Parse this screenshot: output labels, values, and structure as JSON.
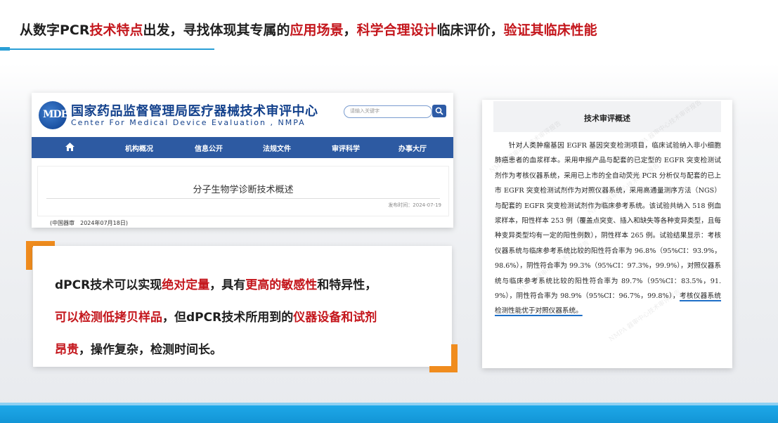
{
  "title": {
    "part1": "从数字PCR",
    "part2_red": "技术特点",
    "part3": "出发，寻找体现其专属的",
    "part4_red": "应用场景",
    "part5": "，",
    "part6_red": "科学合理设计",
    "part7": "临床评价，",
    "part8_red": "验证其临床性能"
  },
  "website": {
    "logo_text": "MDE",
    "org_name_cn": "国家药品监督管理局医疗器械技术审评中心",
    "org_name_en": "Center For Medical Device Evaluation , NMPA",
    "search_placeholder": "请输入关键字",
    "nav": [
      "机构概况",
      "信息公开",
      "法规文件",
      "审评科学",
      "办事大厅"
    ],
    "article_title": "分子生物学诊断技术概述",
    "article_date": "发布时间：2024-07-19",
    "source_note": "(中国器审　2024年07月18日)"
  },
  "highlight": {
    "line1_a": "dPCR技术可以实现",
    "line1_b_red": "绝对定量",
    "line1_c": "，具有",
    "line1_d_red": "更高的敏感性",
    "line1_e": "和特异性，",
    "line2_a_red": "可以检测低拷贝样品",
    "line2_b": "，但dPCR技术所用到的",
    "line2_c_red": "仪器设备和试剂",
    "line3_a_red": "昂贵",
    "line3_b": "，操作复杂，检测时间长。"
  },
  "document": {
    "heading": "技术审评概述",
    "body": "　　针对人类肿瘤基因 EGFR 基因突变检测项目，临床试验纳入非小细胞肺癌患者的血浆样本。采用申报产品与配套的已定型的 EGFR 突变检测试剂作为考核仪器系统，采用已上市的全自动荧光 PCR 分析仪与配套的已上市 EGFR 突变检测试剂作为对照仪器系统，采用高通量测序方法（NGS）与配套的 EGFR 突变检测试剂作为临床参考系统。该试验共纳入 518 例血浆样本，阳性样本 253 例（覆盖点突变、插入和缺失等各种变异类型，且每种变异类型均有一定的阳性例数），阴性样本 265 例。试验结果显示：考核仪器系统与临床参考系统比较的阳性符合率为 96.8%（95%CI：93.9%，98.6%），阴性符合率为 99.3%（95%CI：97.3%，99.9%），对照仪器系统与临床参考系统比较的阳性符合率为 89.7%（95%CI：83.5%，91.9%），阴性符合率为 98.9%（95%CI：96.7%，99.8%），",
    "conclusion": "考核仪器系统检测性能优于对照仪器系统。",
    "watermark": "NMPA 器审中心技术审评报告"
  },
  "colors": {
    "accent_red": "#c4161c",
    "accent_orange": "#f08c1e",
    "accent_blue": "#2a9fd6",
    "nav_blue": "#2d5aa2"
  }
}
